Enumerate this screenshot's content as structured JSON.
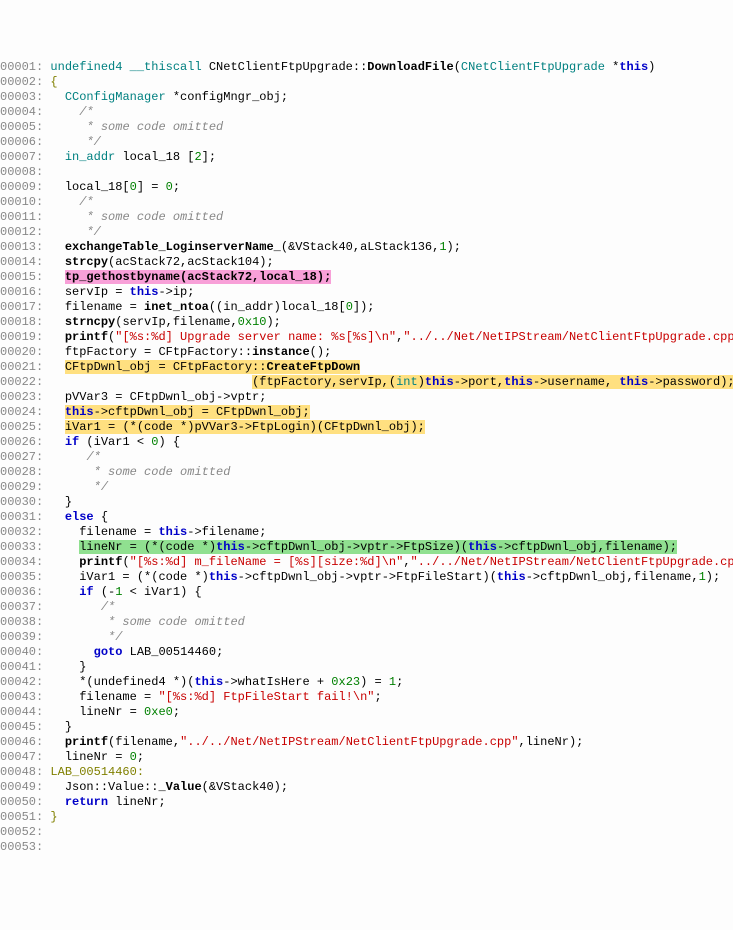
{
  "lines": [
    {
      "n": "00001:",
      "parts": [
        {
          "t": " ",
          "c": ""
        },
        {
          "t": "undefined4",
          "c": "ty"
        },
        {
          "t": " ",
          "c": ""
        },
        {
          "t": "__thiscall",
          "c": "ty"
        },
        {
          "t": " CNetClientFtpUpgrade::",
          "c": ""
        },
        {
          "t": "DownloadFile",
          "c": "fn"
        },
        {
          "t": "(",
          "c": ""
        },
        {
          "t": "CNetClientFtpUpgrade",
          "c": "ty"
        },
        {
          "t": " *",
          "c": ""
        },
        {
          "t": "this",
          "c": "th"
        },
        {
          "t": ")",
          "c": ""
        }
      ]
    },
    {
      "n": "00002:",
      "parts": [
        {
          "t": " {",
          "c": "lbl"
        }
      ]
    },
    {
      "n": "00003:",
      "parts": [
        {
          "t": "   ",
          "c": ""
        },
        {
          "t": "CConfigManager",
          "c": "ty"
        },
        {
          "t": " *configMngr_obj;",
          "c": ""
        }
      ]
    },
    {
      "n": "00004:",
      "parts": [
        {
          "t": "     ",
          "c": ""
        },
        {
          "t": "/*",
          "c": "cm"
        }
      ]
    },
    {
      "n": "00005:",
      "parts": [
        {
          "t": "      ",
          "c": ""
        },
        {
          "t": "* some code omitted",
          "c": "cm"
        }
      ]
    },
    {
      "n": "00006:",
      "parts": [
        {
          "t": "      ",
          "c": ""
        },
        {
          "t": "*/",
          "c": "cm"
        }
      ]
    },
    {
      "n": "00007:",
      "parts": [
        {
          "t": "   ",
          "c": ""
        },
        {
          "t": "in_addr",
          "c": "ty"
        },
        {
          "t": " local_18 [",
          "c": ""
        },
        {
          "t": "2",
          "c": "nu"
        },
        {
          "t": "];",
          "c": ""
        }
      ]
    },
    {
      "n": "00008:",
      "parts": [
        {
          "t": "",
          "c": ""
        }
      ]
    },
    {
      "n": "00009:",
      "parts": [
        {
          "t": "   local_18[",
          "c": ""
        },
        {
          "t": "0",
          "c": "nu"
        },
        {
          "t": "] = ",
          "c": ""
        },
        {
          "t": "0",
          "c": "nu"
        },
        {
          "t": ";",
          "c": ""
        }
      ]
    },
    {
      "n": "00010:",
      "parts": [
        {
          "t": "     ",
          "c": ""
        },
        {
          "t": "/*",
          "c": "cm"
        }
      ]
    },
    {
      "n": "00011:",
      "parts": [
        {
          "t": "      ",
          "c": ""
        },
        {
          "t": "* some code omitted",
          "c": "cm"
        }
      ]
    },
    {
      "n": "00012:",
      "parts": [
        {
          "t": "      ",
          "c": ""
        },
        {
          "t": "*/",
          "c": "cm"
        }
      ]
    },
    {
      "n": "00013:",
      "parts": [
        {
          "t": "   ",
          "c": ""
        },
        {
          "t": "exchangeTable_LoginserverName_",
          "c": "fn"
        },
        {
          "t": "(&VStack40,aLStack136,",
          "c": ""
        },
        {
          "t": "1",
          "c": "nu"
        },
        {
          "t": ");",
          "c": ""
        }
      ]
    },
    {
      "n": "00014:",
      "parts": [
        {
          "t": "   ",
          "c": ""
        },
        {
          "t": "strcpy",
          "c": "fn"
        },
        {
          "t": "(acStack72,acStack104);",
          "c": ""
        }
      ]
    },
    {
      "n": "00015:",
      "parts": [
        {
          "t": "   ",
          "c": ""
        },
        {
          "t": "tp_gethostbyname(acStack72,local_18);",
          "c": "fn",
          "hl": "hl-pink"
        }
      ]
    },
    {
      "n": "00016:",
      "parts": [
        {
          "t": "   servIp = ",
          "c": ""
        },
        {
          "t": "this",
          "c": "th"
        },
        {
          "t": "->ip;",
          "c": ""
        }
      ]
    },
    {
      "n": "00017:",
      "parts": [
        {
          "t": "   filename = ",
          "c": ""
        },
        {
          "t": "inet_ntoa",
          "c": "fn"
        },
        {
          "t": "((in_addr)local_18[",
          "c": ""
        },
        {
          "t": "0",
          "c": "nu"
        },
        {
          "t": "]);",
          "c": ""
        }
      ]
    },
    {
      "n": "00018:",
      "parts": [
        {
          "t": "   ",
          "c": ""
        },
        {
          "t": "strncpy",
          "c": "fn"
        },
        {
          "t": "(servIp,filename,",
          "c": ""
        },
        {
          "t": "0x10",
          "c": "nu"
        },
        {
          "t": ");",
          "c": ""
        }
      ]
    },
    {
      "n": "00019:",
      "parts": [
        {
          "t": "   ",
          "c": ""
        },
        {
          "t": "printf",
          "c": "fn"
        },
        {
          "t": "(",
          "c": ""
        },
        {
          "t": "\"[%s:%d] Upgrade server name: %s[%s]\\n\"",
          "c": "st"
        },
        {
          "t": ",",
          "c": ""
        },
        {
          "t": "\"../../Net/NetIPStream/NetClientFtpUpgrade.cpp",
          "c": "st"
        }
      ]
    },
    {
      "n": "00020:",
      "parts": [
        {
          "t": "   ftpFactory = CFtpFactory::",
          "c": ""
        },
        {
          "t": "instance",
          "c": "fn"
        },
        {
          "t": "();",
          "c": ""
        }
      ]
    },
    {
      "n": "00021:",
      "parts": [
        {
          "t": "   ",
          "c": ""
        },
        {
          "t": "CFtpDwnl_obj = CFtpFactory::",
          "c": "",
          "hl": "hl-yellow"
        },
        {
          "t": "CreateFtpDown",
          "c": "fn",
          "hl": "hl-yellow"
        }
      ]
    },
    {
      "n": "00022:",
      "parts": [
        {
          "t": "                             ",
          "c": ""
        },
        {
          "t": "(ftpFactory,servIp,(",
          "c": "",
          "hl": "hl-yellow"
        },
        {
          "t": "int",
          "c": "ty",
          "hl": "hl-yellow"
        },
        {
          "t": ")",
          "c": "",
          "hl": "hl-yellow"
        },
        {
          "t": "this",
          "c": "th",
          "hl": "hl-yellow"
        },
        {
          "t": "->port,",
          "c": "",
          "hl": "hl-yellow"
        },
        {
          "t": "this",
          "c": "th",
          "hl": "hl-yellow"
        },
        {
          "t": "->username, ",
          "c": "",
          "hl": "hl-yellow"
        },
        {
          "t": "this",
          "c": "th",
          "hl": "hl-yellow"
        },
        {
          "t": "->password);",
          "c": "",
          "hl": "hl-yellow"
        }
      ]
    },
    {
      "n": "00023:",
      "parts": [
        {
          "t": "   pVVar3 = CFtpDwnl_obj->vptr;",
          "c": ""
        }
      ]
    },
    {
      "n": "00024:",
      "parts": [
        {
          "t": "   ",
          "c": ""
        },
        {
          "t": "this",
          "c": "th",
          "hl": "hl-yellow"
        },
        {
          "t": "->cftpDwnl_obj = CFtpDwnl_obj;",
          "c": "",
          "hl": "hl-yellow"
        }
      ]
    },
    {
      "n": "00025:",
      "parts": [
        {
          "t": "   ",
          "c": ""
        },
        {
          "t": "iVar1 = (*(code *)pVVar3->FtpLogin)(CFtpDwnl_obj);",
          "c": "",
          "hl": "hl-yellow"
        }
      ]
    },
    {
      "n": "00026:",
      "parts": [
        {
          "t": "   ",
          "c": ""
        },
        {
          "t": "if",
          "c": "kw"
        },
        {
          "t": " (iVar1 < ",
          "c": ""
        },
        {
          "t": "0",
          "c": "nu"
        },
        {
          "t": ") {",
          "c": ""
        }
      ]
    },
    {
      "n": "00027:",
      "parts": [
        {
          "t": "      ",
          "c": ""
        },
        {
          "t": "/*",
          "c": "cm"
        }
      ]
    },
    {
      "n": "00028:",
      "parts": [
        {
          "t": "       ",
          "c": ""
        },
        {
          "t": "* some code omitted",
          "c": "cm"
        }
      ]
    },
    {
      "n": "00029:",
      "parts": [
        {
          "t": "       ",
          "c": ""
        },
        {
          "t": "*/",
          "c": "cm"
        }
      ]
    },
    {
      "n": "00030:",
      "parts": [
        {
          "t": "   }",
          "c": ""
        }
      ]
    },
    {
      "n": "00031:",
      "parts": [
        {
          "t": "   ",
          "c": ""
        },
        {
          "t": "else",
          "c": "kw"
        },
        {
          "t": " {",
          "c": ""
        }
      ]
    },
    {
      "n": "00032:",
      "parts": [
        {
          "t": "     filename = ",
          "c": ""
        },
        {
          "t": "this",
          "c": "th"
        },
        {
          "t": "->filename;",
          "c": ""
        }
      ]
    },
    {
      "n": "00033:",
      "parts": [
        {
          "t": "     ",
          "c": ""
        },
        {
          "t": "lineNr = (*(code *)",
          "c": "",
          "hl": "hl-green"
        },
        {
          "t": "this",
          "c": "th",
          "hl": "hl-green"
        },
        {
          "t": "->cftpDwnl_obj->vptr->FtpSize)(",
          "c": "",
          "hl": "hl-green"
        },
        {
          "t": "this",
          "c": "th",
          "hl": "hl-green"
        },
        {
          "t": "->cftpDwnl_obj,filename);",
          "c": "",
          "hl": "hl-green"
        }
      ]
    },
    {
      "n": "00034:",
      "parts": [
        {
          "t": "     ",
          "c": ""
        },
        {
          "t": "printf",
          "c": "fn"
        },
        {
          "t": "(",
          "c": ""
        },
        {
          "t": "\"[%s:%d] m_fileName = [%s][size:%d]\\n\"",
          "c": "st"
        },
        {
          "t": ",",
          "c": ""
        },
        {
          "t": "\"../../Net/NetIPStream/NetClientFtpUpgrade.cp",
          "c": "st"
        }
      ]
    },
    {
      "n": "00035:",
      "parts": [
        {
          "t": "     iVar1 = (*(code *)",
          "c": ""
        },
        {
          "t": "this",
          "c": "th"
        },
        {
          "t": "->cftpDwnl_obj->vptr->FtpFileStart)(",
          "c": ""
        },
        {
          "t": "this",
          "c": "th"
        },
        {
          "t": "->cftpDwnl_obj,filename,",
          "c": ""
        },
        {
          "t": "1",
          "c": "nu"
        },
        {
          "t": ");",
          "c": ""
        }
      ]
    },
    {
      "n": "00036:",
      "parts": [
        {
          "t": "     ",
          "c": ""
        },
        {
          "t": "if",
          "c": "kw"
        },
        {
          "t": " (-",
          "c": ""
        },
        {
          "t": "1",
          "c": "nu"
        },
        {
          "t": " < iVar1) {",
          "c": ""
        }
      ]
    },
    {
      "n": "00037:",
      "parts": [
        {
          "t": "        ",
          "c": ""
        },
        {
          "t": "/*",
          "c": "cm"
        }
      ]
    },
    {
      "n": "00038:",
      "parts": [
        {
          "t": "         ",
          "c": ""
        },
        {
          "t": "* some code omitted",
          "c": "cm"
        }
      ]
    },
    {
      "n": "00039:",
      "parts": [
        {
          "t": "         ",
          "c": ""
        },
        {
          "t": "*/",
          "c": "cm"
        }
      ]
    },
    {
      "n": "00040:",
      "parts": [
        {
          "t": "       ",
          "c": ""
        },
        {
          "t": "goto",
          "c": "kw"
        },
        {
          "t": " LAB_00514460;",
          "c": ""
        }
      ]
    },
    {
      "n": "00041:",
      "parts": [
        {
          "t": "     }",
          "c": ""
        }
      ]
    },
    {
      "n": "00042:",
      "parts": [
        {
          "t": "     *(undefined4 *)(",
          "c": ""
        },
        {
          "t": "this",
          "c": "th"
        },
        {
          "t": "->whatIsHere + ",
          "c": ""
        },
        {
          "t": "0x23",
          "c": "nu"
        },
        {
          "t": ") = ",
          "c": ""
        },
        {
          "t": "1",
          "c": "nu"
        },
        {
          "t": ";",
          "c": ""
        }
      ]
    },
    {
      "n": "00043:",
      "parts": [
        {
          "t": "     filename = ",
          "c": ""
        },
        {
          "t": "\"[%s:%d] FtpFileStart fail!\\n\"",
          "c": "st"
        },
        {
          "t": ";",
          "c": ""
        }
      ]
    },
    {
      "n": "00044:",
      "parts": [
        {
          "t": "     lineNr = ",
          "c": ""
        },
        {
          "t": "0xe0",
          "c": "nu"
        },
        {
          "t": ";",
          "c": ""
        }
      ]
    },
    {
      "n": "00045:",
      "parts": [
        {
          "t": "   }",
          "c": ""
        }
      ]
    },
    {
      "n": "00046:",
      "parts": [
        {
          "t": "   ",
          "c": ""
        },
        {
          "t": "printf",
          "c": "fn"
        },
        {
          "t": "(filename,",
          "c": ""
        },
        {
          "t": "\"../../Net/NetIPStream/NetClientFtpUpgrade.cpp\"",
          "c": "st"
        },
        {
          "t": ",lineNr);",
          "c": ""
        }
      ]
    },
    {
      "n": "00047:",
      "parts": [
        {
          "t": "   lineNr = ",
          "c": ""
        },
        {
          "t": "0",
          "c": "nu"
        },
        {
          "t": ";",
          "c": ""
        }
      ]
    },
    {
      "n": "00048:",
      "parts": [
        {
          "t": " ",
          "c": ""
        },
        {
          "t": "LAB_00514460:",
          "c": "lbl"
        }
      ]
    },
    {
      "n": "00049:",
      "parts": [
        {
          "t": "   Json::Value::",
          "c": ""
        },
        {
          "t": "_Value",
          "c": "fn"
        },
        {
          "t": "(&VStack40);",
          "c": ""
        }
      ]
    },
    {
      "n": "00050:",
      "parts": [
        {
          "t": "   ",
          "c": ""
        },
        {
          "t": "return",
          "c": "kw"
        },
        {
          "t": " lineNr;",
          "c": ""
        }
      ]
    },
    {
      "n": "00051:",
      "parts": [
        {
          "t": " }",
          "c": "lbl"
        }
      ]
    },
    {
      "n": "00052:",
      "parts": [
        {
          "t": "",
          "c": ""
        }
      ]
    },
    {
      "n": "00053:",
      "parts": [
        {
          "t": "",
          "c": ""
        }
      ]
    }
  ]
}
